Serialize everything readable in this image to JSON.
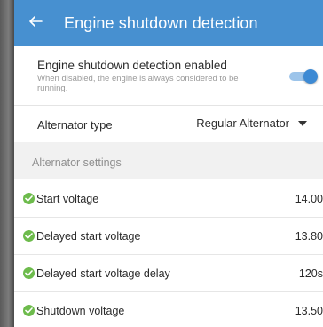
{
  "appbar": {
    "title": "Engine shutdown detection",
    "back_icon": "arrow-left-icon"
  },
  "toggle": {
    "title": "Engine shutdown detection enabled",
    "description": "When disabled, the engine is always considered to be running.",
    "enabled": true
  },
  "alternator": {
    "label": "Alternator type",
    "value": "Regular Alternator"
  },
  "section": {
    "title": "Alternator settings"
  },
  "settings": [
    {
      "label": "Start voltage",
      "value": "14.00",
      "status": "valid"
    },
    {
      "label": "Delayed start voltage",
      "value": "13.80",
      "status": "valid"
    },
    {
      "label": "Delayed start voltage delay",
      "value": "120s",
      "status": "valid"
    },
    {
      "label": "Shutdown voltage",
      "value": "13.50",
      "status": "valid"
    }
  ],
  "colors": {
    "appbar": "#4790d0",
    "switch_on": "#3d8ad4",
    "check": "#6dbb4c"
  }
}
